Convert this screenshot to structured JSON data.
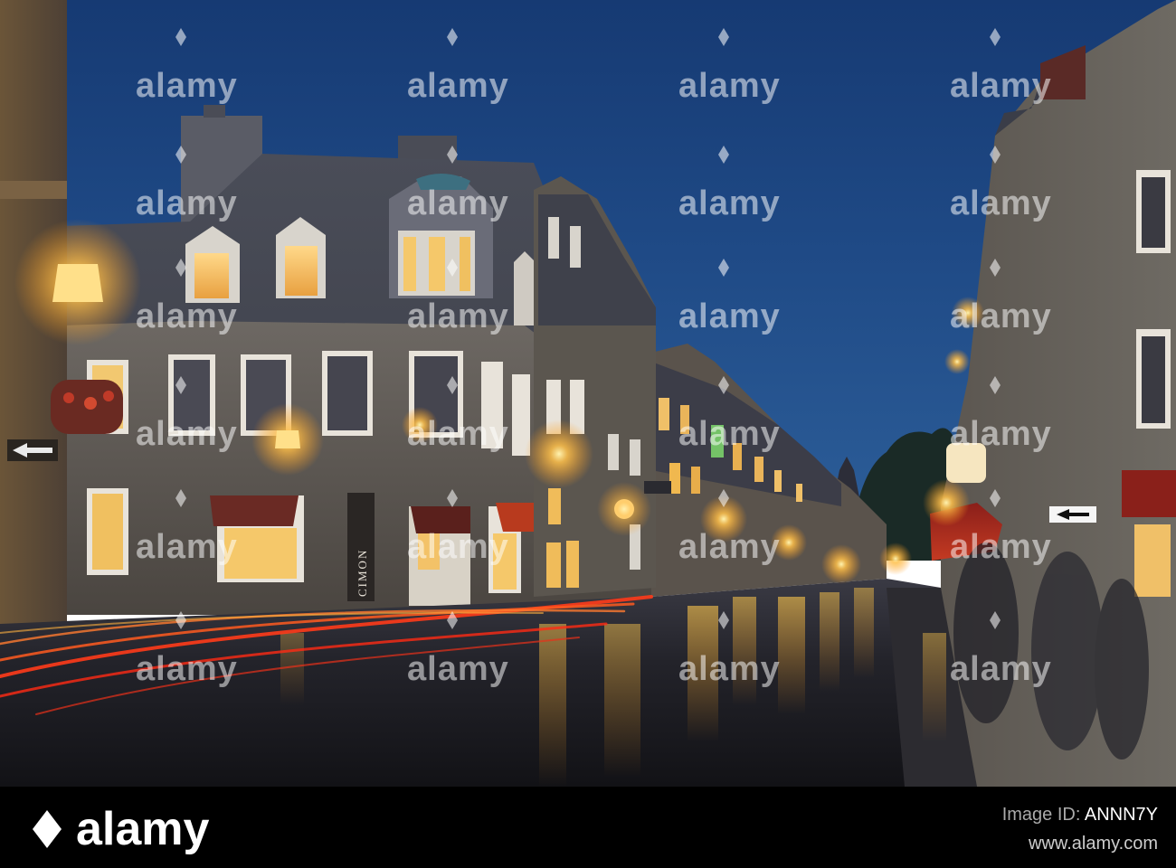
{
  "watermark": {
    "brand": "alamy",
    "icon": "alamy-diamond-icon",
    "color": "#ffffff"
  },
  "footer": {
    "brand": "alamy",
    "image_id_label": "Image ID:",
    "image_id": "ANNN7Y",
    "url": "www.alamy.com",
    "background": "#000000"
  },
  "scene": {
    "shop_sign": "CIMON",
    "sky_color": "#1f4a86",
    "light_color": "#ffb53a",
    "trail_color": "#ff3b1a"
  }
}
